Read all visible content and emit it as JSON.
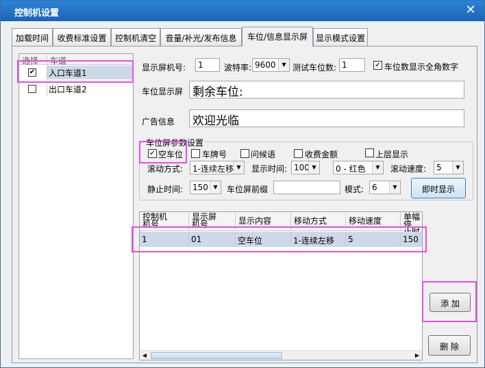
{
  "window": {
    "title": "控制机设置"
  },
  "tabs": [
    {
      "label": "加载时间"
    },
    {
      "label": "收费标准设置"
    },
    {
      "label": "控制机清空"
    },
    {
      "label": "音量/补光/发布信息"
    },
    {
      "label": "车位/信息显示屏"
    },
    {
      "label": "显示模式设置"
    }
  ],
  "lanes": {
    "header_select": "选择",
    "header_lane": "车道",
    "items": [
      {
        "label": "入口车道1",
        "checked": "✔"
      },
      {
        "label": "出口车道2",
        "checked": ""
      }
    ]
  },
  "form": {
    "screen_no_label": "显示屏机号:",
    "screen_no": "1",
    "baud_label": "波特率:",
    "baud": "9600",
    "spaces_label": "测试车位数:",
    "spaces": "1",
    "fullwidth_label": "车位数显示全角数字",
    "fullwidth_check": "✔",
    "space_screen_label": "车位显示屏",
    "space_screen_text": "剩余车位:",
    "ad_label": "广告信息",
    "ad_text": "欢迎光临"
  },
  "params": {
    "legend": "车位屏参数设置",
    "empty_space_label": "空车位",
    "empty_space_check": "✔",
    "plate_label": "车牌号",
    "greeting_label": "问候语",
    "fee_label": "收费金额",
    "upper_label": "上层显示",
    "scroll_mode_label": "滚动方式:",
    "scroll_mode": "1-连续左移",
    "display_time_label": "显示时间:",
    "display_time": "100",
    "color": "0 - 红色",
    "scroll_speed_label": "滚动速度:",
    "scroll_speed": "5",
    "still_time_label": "静止时间:",
    "still_time": "150",
    "prefix_label": "车位屏前缀",
    "prefix_value": "",
    "mode_label": "模式:",
    "mode": "6",
    "show_now": "即时显示"
  },
  "table": {
    "headers": [
      "控制机\n机号",
      "显示屏\n机号",
      "显示内容",
      "移动方式",
      "移动速度",
      "单幅停\n止时间"
    ],
    "rows": [
      [
        "1",
        "01",
        "空车位",
        "1-连续左移",
        "5",
        "150"
      ]
    ]
  },
  "buttons": {
    "add": "添  加",
    "delete": "删  除"
  }
}
